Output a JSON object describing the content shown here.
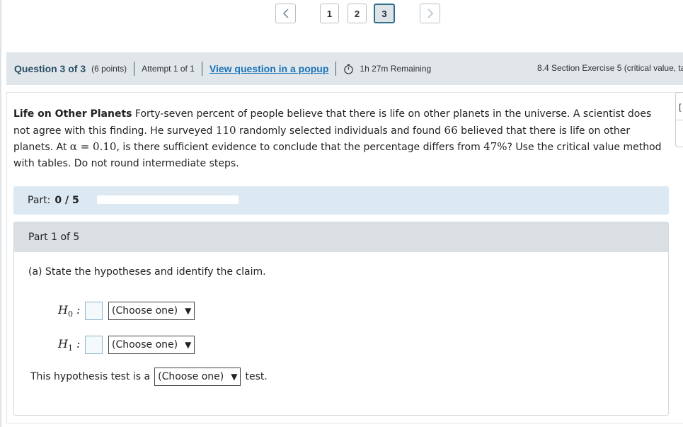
{
  "pager": {
    "pages": [
      "1",
      "2",
      "3"
    ],
    "current": "3"
  },
  "info": {
    "question_title": "Question 3 of 3",
    "points": "(6 points)",
    "attempt": "Attempt 1 of 1",
    "popup_link": "View question in a popup",
    "time_remaining": "1h 27m Remaining",
    "section": "8.4 Section Exercise 5 (critical value, ta"
  },
  "problem": {
    "title": "Life on Other Planets",
    "text_1": " Forty-seven percent of people believe that there is life on other planets in the universe. A scientist does not agree with this finding. He surveyed ",
    "n": "110",
    "text_2": " randomly selected individuals and found ",
    "x": "66",
    "text_3": " believed that there is life on other planets. At ",
    "alpha": "α = 0.10",
    "text_4": ", is there sufficient evidence to conclude that the percentage differs from ",
    "p": "47%",
    "text_5": "? Use the critical value method with tables. Do not round intermediate steps."
  },
  "part_progress": {
    "label": "Part:",
    "score": "0 / 5",
    "fraction": 0
  },
  "part": {
    "header": "Part 1 of 5",
    "question": "(a) State the hypotheses and identify the claim.",
    "h0_label": "H",
    "h0_sub": "0",
    "h1_label": "H",
    "h1_sub": "1",
    "choose": "(Choose one)",
    "test_prefix": "This hypothesis test is a",
    "test_suffix": "test."
  },
  "colors": {
    "accent": "#2e6f8c",
    "link": "#1a73b8",
    "bar_bg": "#e0e6ea",
    "part_bar_bg": "#dde9f2"
  }
}
